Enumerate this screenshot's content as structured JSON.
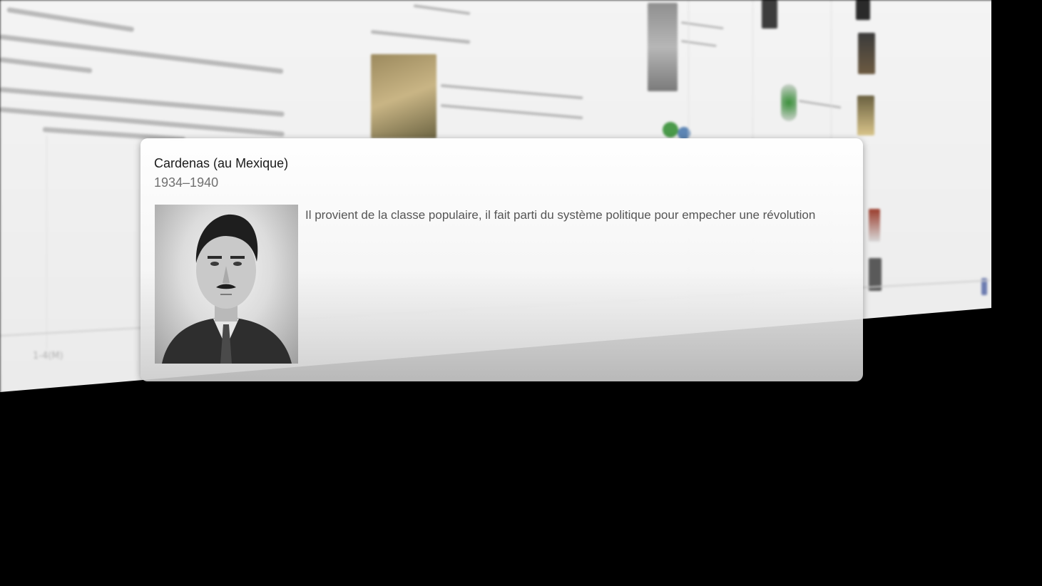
{
  "card": {
    "title": "Cardenas (au Mexique)",
    "dates": "1934–1940",
    "description": "Il provient de la classe populaire, il fait parti du système politique pour empecher une révolution",
    "portrait_icon": "portrait-photo-icon"
  },
  "timeline": {
    "axis_tick": "1-4(M)"
  },
  "colors": {
    "page_background": "#000000",
    "timeline_background": "#f0f0f0",
    "card_title": "#1a1a1a",
    "card_dates": "#707070",
    "card_text": "#555555"
  }
}
